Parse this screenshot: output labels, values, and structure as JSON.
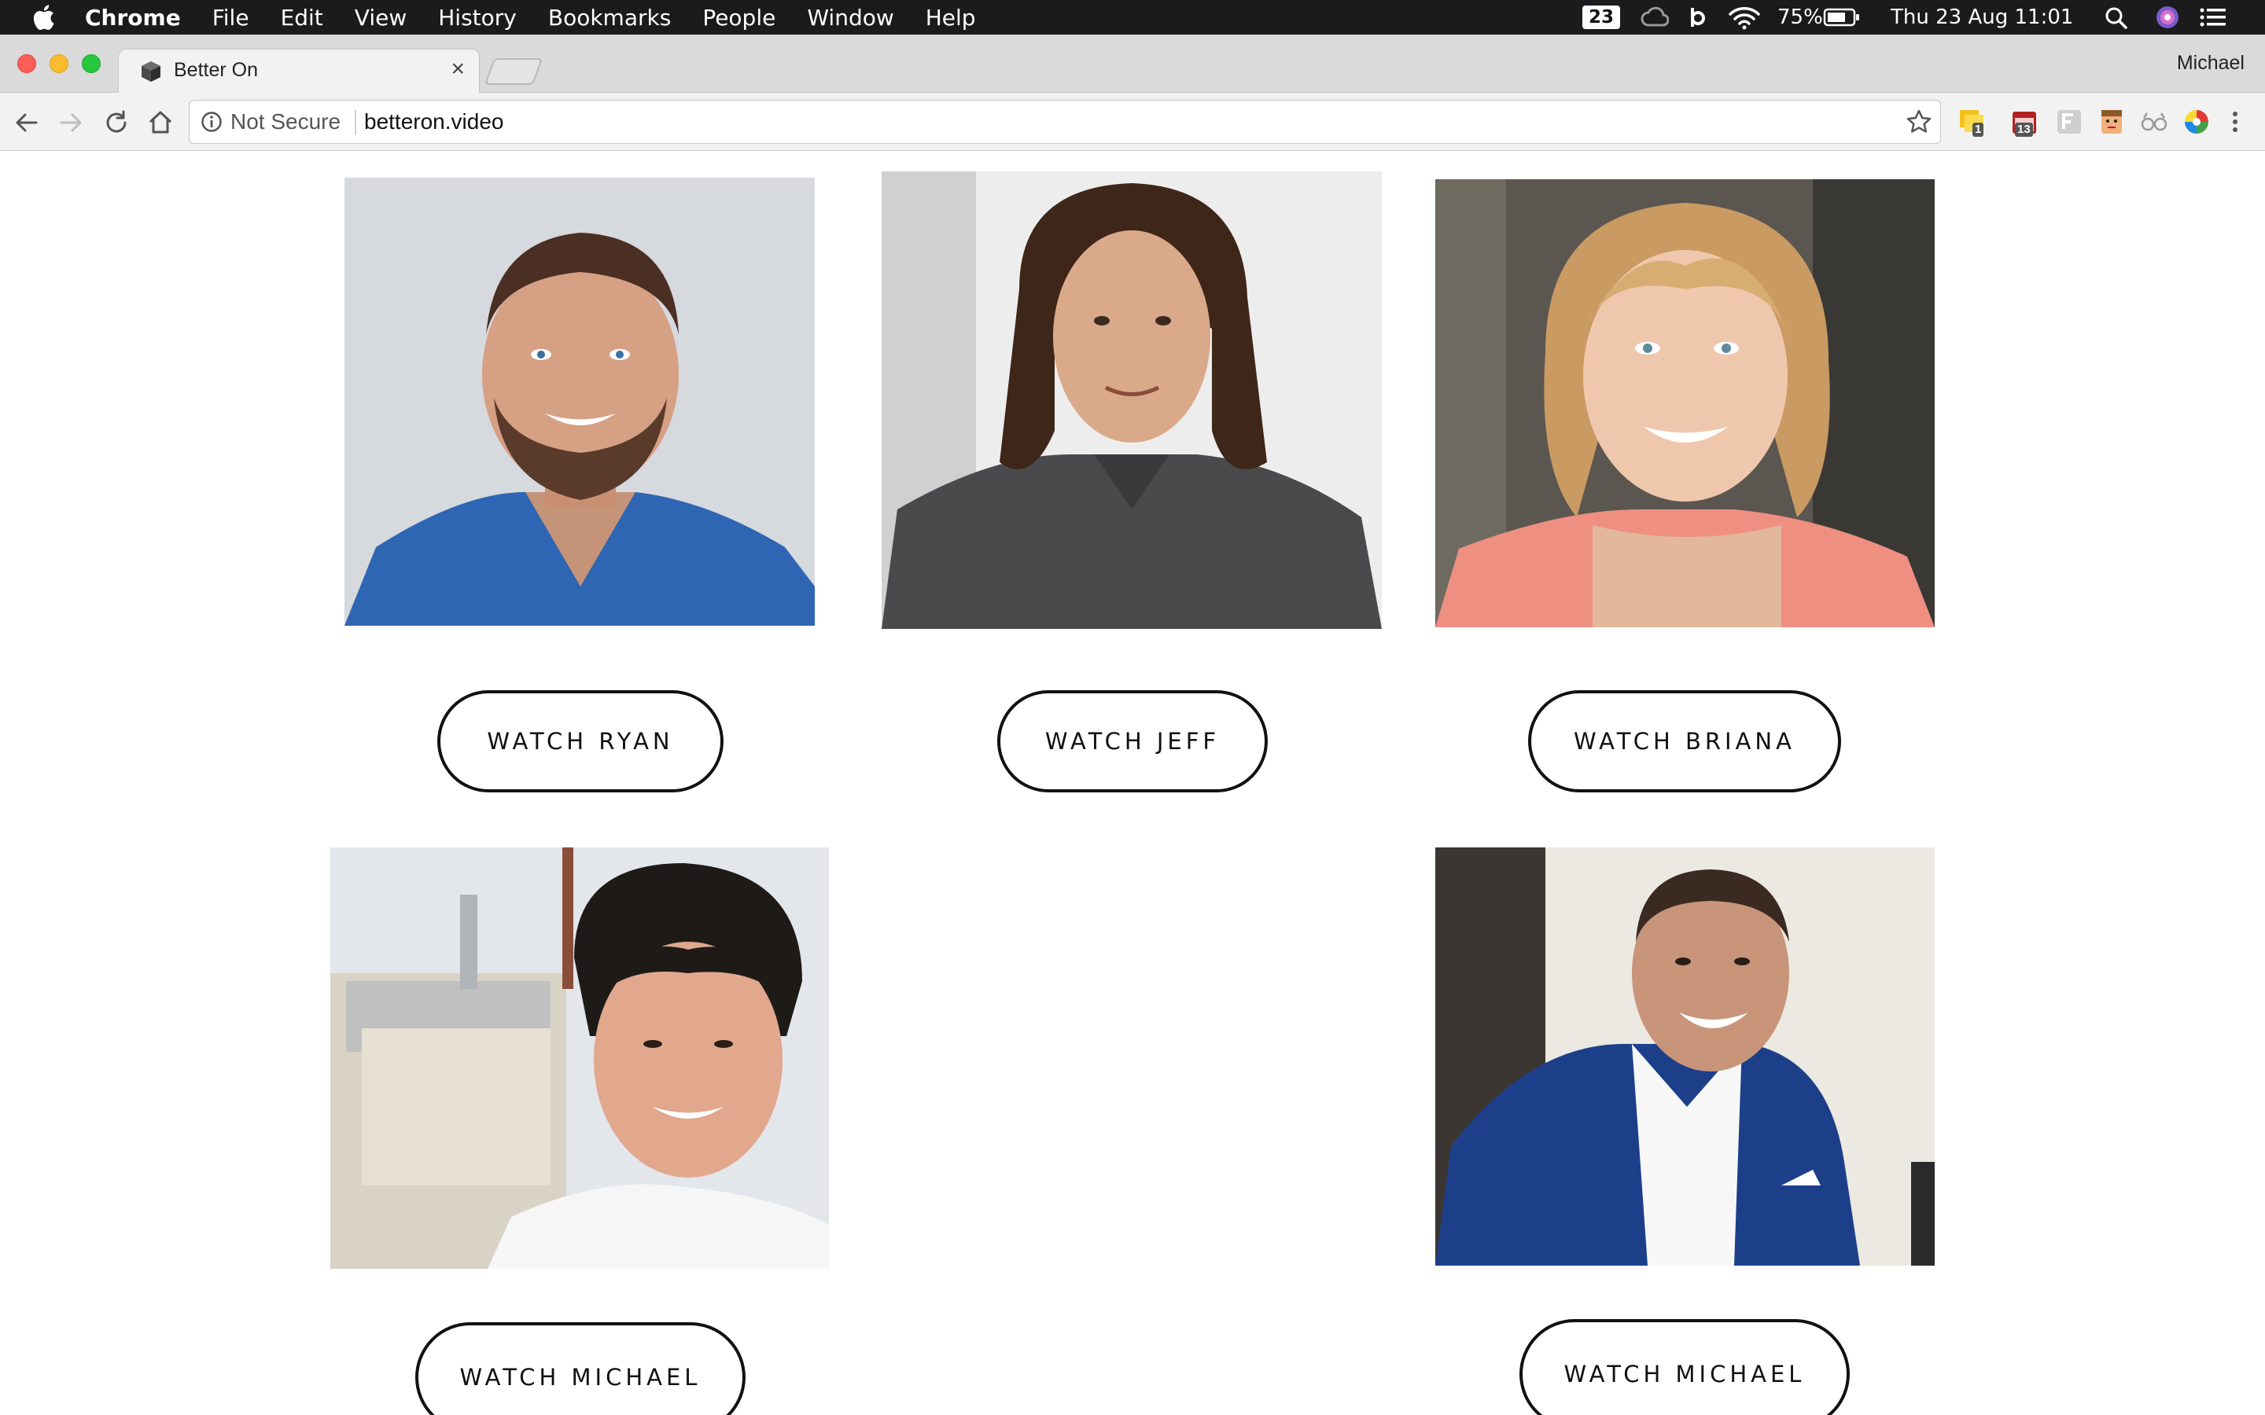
{
  "menubar": {
    "app_name": "Chrome",
    "menus": [
      "File",
      "Edit",
      "View",
      "History",
      "Bookmarks",
      "People",
      "Window",
      "Help"
    ],
    "badge": "23",
    "battery": "75%",
    "datetime": "Thu 23 Aug  11:01"
  },
  "browser": {
    "tab_title": "Better On",
    "tab_close": "×",
    "profile_name": "Michael",
    "security_label": "Not Secure",
    "url": "betteron.video",
    "extension_badges": [
      "1",
      "13"
    ]
  },
  "people": [
    {
      "name": "Ryan",
      "button_label": "WATCH RYAN"
    },
    {
      "name": "Jeff",
      "button_label": "WATCH JEFF"
    },
    {
      "name": "Briana",
      "button_label": "WATCH BRIANA"
    },
    {
      "name": "Michael",
      "button_label": "WATCH MICHAEL"
    },
    {
      "name": "Michael",
      "button_label": "WATCH MICHAEL"
    }
  ],
  "colors": {
    "menubar_bg": "#1b1b1d",
    "tabstrip_bg": "#dadada",
    "toolbar_bg": "#f2f2f2",
    "button_border": "#111111",
    "page_bg": "#ffffff"
  }
}
